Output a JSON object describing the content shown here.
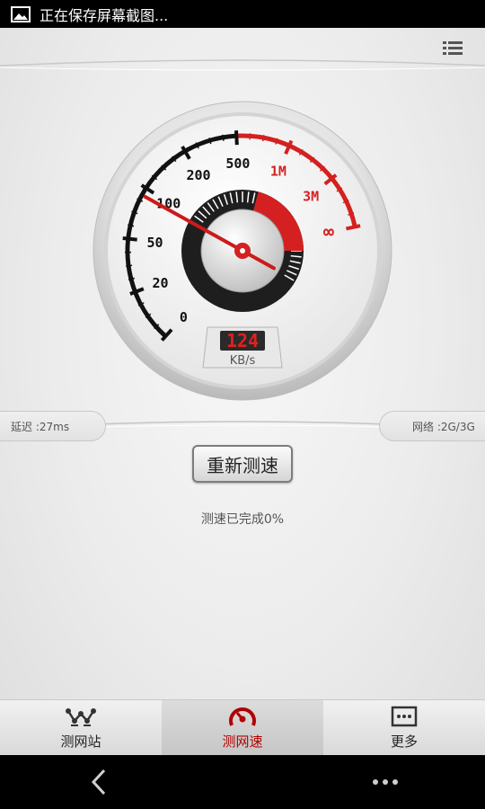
{
  "status_bar": {
    "notification_text": "正在保存屏幕截图...",
    "icon": "image-icon"
  },
  "header": {
    "menu_icon": "list-menu-icon"
  },
  "gauge": {
    "scale_labels": [
      "0",
      "20",
      "50",
      "100",
      "200",
      "500",
      "1M",
      "3M",
      "∞"
    ],
    "digital_value": "124",
    "unit": "KB/s",
    "accent_color": "#d42020"
  },
  "info": {
    "latency": "延迟 :27ms",
    "network": "网络 :2G/3G"
  },
  "actions": {
    "retest_label": "重新测速"
  },
  "progress": {
    "status_text": "测速已完成0%"
  },
  "bottom_nav": [
    {
      "label": "测网站",
      "icon": "network-graph-icon",
      "active": false
    },
    {
      "label": "测网速",
      "icon": "speedometer-icon",
      "active": true
    },
    {
      "label": "更多",
      "icon": "more-box-icon",
      "active": false
    }
  ],
  "system_nav": {
    "back_icon": "back-chevron-icon",
    "more_icon": "overflow-dots-icon"
  }
}
